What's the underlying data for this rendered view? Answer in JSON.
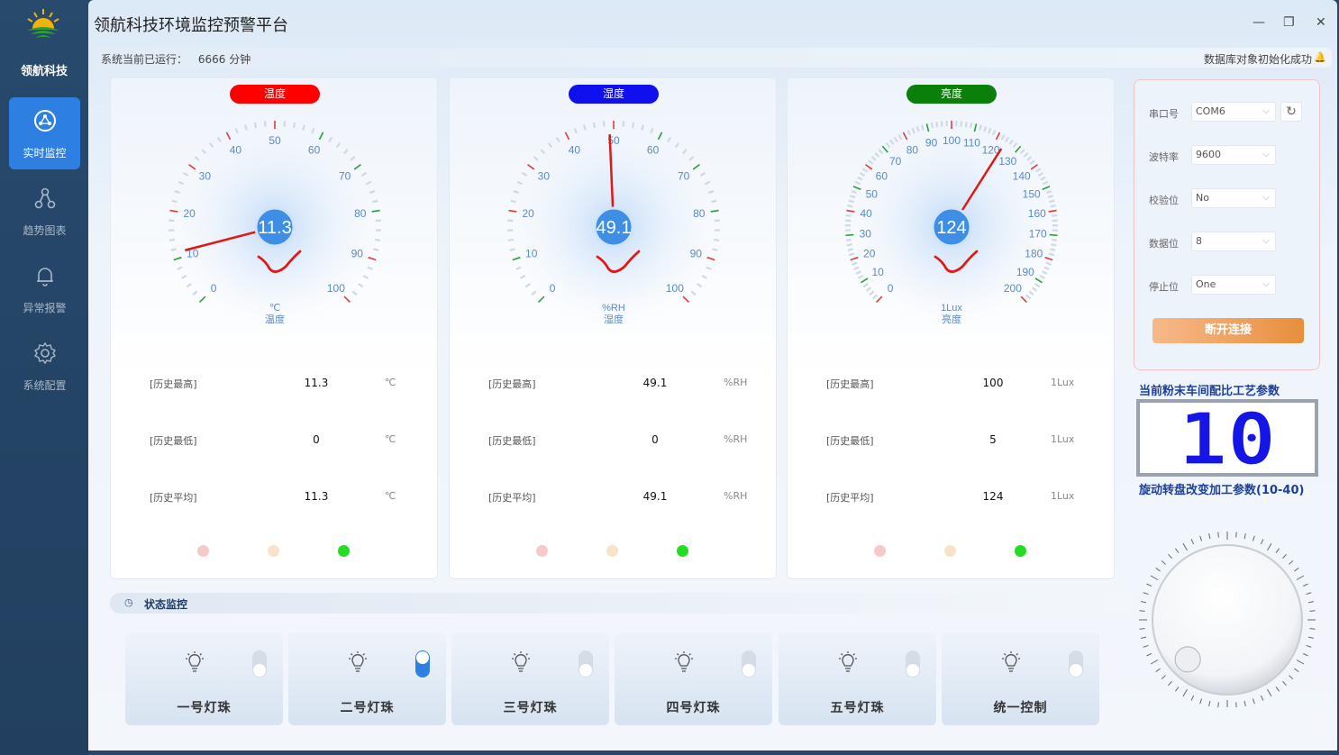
{
  "app": {
    "brand": "领航科技",
    "title": "领航科技环境监控预警平台"
  },
  "nav": [
    {
      "label": "实时监控",
      "icon": "monitor-icon",
      "active": true
    },
    {
      "label": "趋势图表",
      "icon": "graph-icon",
      "active": false
    },
    {
      "label": "异常报警",
      "icon": "bell-icon",
      "active": false
    },
    {
      "label": "系统配置",
      "icon": "gear-icon",
      "active": false
    }
  ],
  "statusbar": {
    "runtime_label": "系统当前已运行：",
    "runtime_value": "6666 分钟",
    "message": "数据库对象初始化成功"
  },
  "gauges": [
    {
      "title": "温度",
      "color": "#ff0000",
      "value": 11.3,
      "display": "11.3",
      "min": 0,
      "max": 100,
      "ticks": [
        "0",
        "10",
        "20",
        "30",
        "40",
        "50",
        "60",
        "70",
        "80",
        "90",
        "100"
      ],
      "unit": "℃",
      "sublabel": "温度",
      "stats": [
        {
          "label": "[历史最高]",
          "value": "11.3",
          "unit": "℃"
        },
        {
          "label": "[历史最低]",
          "value": "0",
          "unit": "℃"
        },
        {
          "label": "[历史平均]",
          "value": "11.3",
          "unit": "℃"
        }
      ],
      "lights": [
        "#f8c9c9",
        "#f8e3c8",
        "#22dd22"
      ]
    },
    {
      "title": "湿度",
      "color": "#1010ee",
      "value": 49.1,
      "display": "49.1",
      "min": 0,
      "max": 100,
      "ticks": [
        "0",
        "10",
        "20",
        "30",
        "40",
        "50",
        "60",
        "70",
        "80",
        "90",
        "100"
      ],
      "unit": "%RH",
      "sublabel": "湿度",
      "stats": [
        {
          "label": "[历史最高]",
          "value": "49.1",
          "unit": "%RH"
        },
        {
          "label": "[历史最低]",
          "value": "0",
          "unit": "%RH"
        },
        {
          "label": "[历史平均]",
          "value": "49.1",
          "unit": "%RH"
        }
      ],
      "lights": [
        "#f8c9c9",
        "#f8e3c8",
        "#22dd22"
      ]
    },
    {
      "title": "亮度",
      "color": "#0a7f0a",
      "value": 124,
      "display": "124",
      "min": 0,
      "max": 200,
      "ticks": [
        "0",
        "10",
        "20",
        "30",
        "40",
        "50",
        "60",
        "70",
        "80",
        "90",
        "100",
        "110",
        "120",
        "130",
        "140",
        "150",
        "160",
        "170",
        "180",
        "190",
        "200"
      ],
      "unit": "1Lux",
      "sublabel": "亮度",
      "stats": [
        {
          "label": "[历史最高]",
          "value": "100",
          "unit": "1Lux"
        },
        {
          "label": "[历史最低]",
          "value": "5",
          "unit": "1Lux"
        },
        {
          "label": "[历史平均]",
          "value": "124",
          "unit": "1Lux"
        }
      ],
      "lights": [
        "#f8c9c9",
        "#f8e3c8",
        "#22dd22"
      ]
    }
  ],
  "serial": {
    "port_label": "串口号",
    "port_value": "COM6",
    "baud_label": "波特率",
    "baud_value": "9600",
    "parity_label": "校验位",
    "parity_value": "No",
    "databits_label": "数据位",
    "databits_value": "8",
    "stopbits_label": "停止位",
    "stopbits_value": "One",
    "disconnect_label": "断开连接"
  },
  "process": {
    "title": "当前粉末车间配比工艺参数",
    "value": "10",
    "knob_title": "旋动转盘改变加工参数(10-40)",
    "knob_value": 10,
    "knob_min": 10,
    "knob_max": 40
  },
  "status_section": {
    "title": "状态监控",
    "lamps": [
      {
        "name": "一号灯珠",
        "on": false
      },
      {
        "name": "二号灯珠",
        "on": true
      },
      {
        "name": "三号灯珠",
        "on": false
      },
      {
        "name": "四号灯珠",
        "on": false
      },
      {
        "name": "五号灯珠",
        "on": false
      },
      {
        "name": "统一控制",
        "on": false
      }
    ]
  }
}
